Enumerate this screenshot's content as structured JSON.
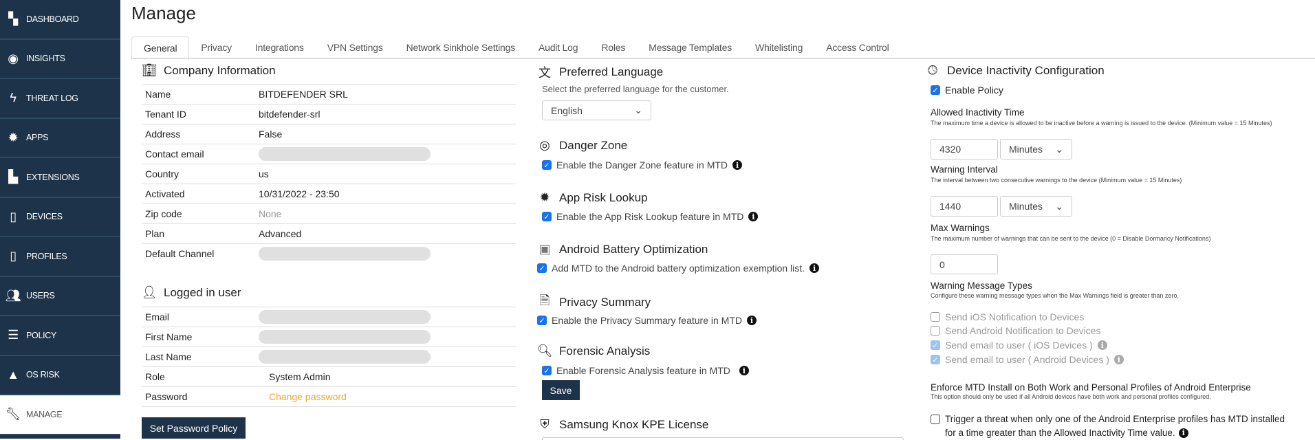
{
  "sidebar": {
    "items": [
      {
        "label": "DASHBOARD",
        "icon": "dashboard-icon"
      },
      {
        "label": "INSIGHTS",
        "icon": "eye-icon"
      },
      {
        "label": "THREAT LOG",
        "icon": "lightning-icon"
      },
      {
        "label": "APPS",
        "icon": "bug-icon"
      },
      {
        "label": "EXTENSIONS",
        "icon": "puzzle-icon"
      },
      {
        "label": "DEVICES",
        "icon": "phone-icon"
      },
      {
        "label": "PROFILES",
        "icon": "phone-gear-icon"
      },
      {
        "label": "USERS",
        "icon": "users-icon"
      },
      {
        "label": "POLICY",
        "icon": "list-icon"
      },
      {
        "label": "OS RISK",
        "icon": "warning-icon"
      },
      {
        "label": "MANAGE",
        "icon": "wrench-icon",
        "active": true
      }
    ]
  },
  "page": {
    "title": "Manage"
  },
  "tabs": [
    "General",
    "Privacy",
    "Integrations",
    "VPN Settings",
    "Network Sinkhole Settings",
    "Audit Log",
    "Roles",
    "Message Templates",
    "Whitelisting",
    "Access Control"
  ],
  "company": {
    "title": "Company Information",
    "rows": [
      {
        "k": "Name",
        "v": "BITDEFENDER SRL"
      },
      {
        "k": "Tenant ID",
        "v": "bitdefender-srl"
      },
      {
        "k": "Address",
        "v": "False"
      },
      {
        "k": "Contact email",
        "v": null
      },
      {
        "k": "Country",
        "v": "us"
      },
      {
        "k": "Activated",
        "v": "10/31/2022 - 23:50"
      },
      {
        "k": "Zip code",
        "v": "None"
      },
      {
        "k": "Plan",
        "v": "Advanced"
      },
      {
        "k": "Default Channel",
        "v": null
      }
    ]
  },
  "user": {
    "title": "Logged in user",
    "rows": [
      {
        "k": "Email",
        "v": null
      },
      {
        "k": "First Name",
        "v": null
      },
      {
        "k": "Last Name",
        "v": null
      },
      {
        "k": "Role",
        "v": "System Admin"
      },
      {
        "k": "Password",
        "v": "Change password"
      }
    ],
    "set_policy": "Set Password Policy"
  },
  "language": {
    "title": "Preferred Language",
    "desc": "Select the preferred language for the customer.",
    "value": "English"
  },
  "danger": {
    "title": "Danger Zone",
    "label": "Enable the Danger Zone feature in MTD"
  },
  "apprisk": {
    "title": "App Risk Lookup",
    "label": "Enable the App Risk Lookup feature in MTD"
  },
  "battery": {
    "title": "Android Battery Optimization",
    "label": "Add MTD to the Android battery optimization exemption list."
  },
  "privacy": {
    "title": "Privacy Summary",
    "label": "Enable the Privacy Summary feature in MTD"
  },
  "forensic": {
    "title": "Forensic Analysis",
    "label": "Enable Forensic Analysis feature in MTD",
    "save": "Save"
  },
  "knox": {
    "title": "Samsung Knox KPE License"
  },
  "inactivity": {
    "title": "Device Inactivity Configuration",
    "enable": "Enable Policy",
    "allowed": {
      "label": "Allowed Inactivity Time",
      "desc": "The maximum time a device is allowed to be inactive before a warning is issued to the device. (Minimum value = 15 Minutes)",
      "value": "4320",
      "unit": "Minutes"
    },
    "interval": {
      "label": "Warning Interval",
      "desc": "The interval between two consecutive warnings to the device (Minimum value = 15 Minutes)",
      "value": "1440",
      "unit": "Minutes"
    },
    "max": {
      "label": "Max Warnings",
      "desc": "The maximum number of warnings that can be sent to the device (0 = Disable Dormancy Notifications)",
      "value": "0"
    },
    "types": {
      "label": "Warning Message Types",
      "desc": "Configure these warning message types when the Max Warnings field is greater than zero.",
      "items": [
        {
          "label": "Send iOS Notification to Devices",
          "checked": false
        },
        {
          "label": "Send Android Notification to Devices",
          "checked": false
        },
        {
          "label": "Send email to user ( iOS Devices )",
          "checked": true
        },
        {
          "label": "Send email to user ( Android Devices )",
          "checked": true
        }
      ]
    },
    "enforce": {
      "label": "Enforce MTD Install on Both Work and Personal Profiles of Android Enterprise",
      "desc": "This option should only be used if all Android devices have both work and personal profiles configured.",
      "trigger_line1": "Trigger a threat when only one of the Android Enterprise profiles has MTD installed",
      "trigger_line2": "for a time greater than the Allowed Inactivity Time value."
    }
  },
  "colors": {
    "sidebar": "#1d3349",
    "accent": "#1a73e8",
    "link": "#f5a623"
  }
}
